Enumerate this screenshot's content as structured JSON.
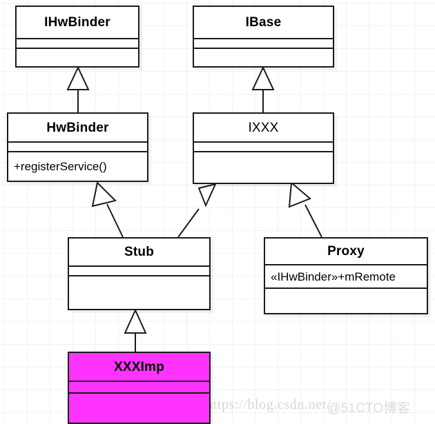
{
  "diagram": {
    "type": "uml-class-diagram",
    "background": "#ffffff",
    "grid_color": "#f2f2f2",
    "line_color": "#1a1a1a",
    "highlight_color": "#ff33ff",
    "classes": [
      {
        "id": "ihwbinder",
        "name": "IHwBinder",
        "title_bold": true,
        "attributes": "",
        "operations": "",
        "highlighted": false
      },
      {
        "id": "ibase",
        "name": "IBase",
        "title_bold": true,
        "attributes": "",
        "operations": "",
        "highlighted": false
      },
      {
        "id": "hwbinder",
        "name": "HwBinder",
        "title_bold": true,
        "attributes": "",
        "operations": "+registerService()",
        "highlighted": false
      },
      {
        "id": "ixxx",
        "name": "IXXX",
        "title_bold": false,
        "attributes": "",
        "operations": "",
        "highlighted": false
      },
      {
        "id": "stub",
        "name": "Stub",
        "title_bold": true,
        "attributes": "",
        "operations": "",
        "highlighted": false
      },
      {
        "id": "proxy",
        "name": "Proxy",
        "title_bold": true,
        "attributes": "«IHwBinder»+mRemote",
        "operations": "",
        "highlighted": false
      },
      {
        "id": "xxximp",
        "name": "XXXImp",
        "title_bold": true,
        "attributes": "",
        "operations": "",
        "highlighted": true
      }
    ],
    "relationships": [
      {
        "id": "hwbinder-ihwbinder",
        "type": "generalization",
        "from": "HwBinder",
        "to": "IHwBinder"
      },
      {
        "id": "ixxx-ibase",
        "type": "generalization",
        "from": "IXXX",
        "to": "IBase"
      },
      {
        "id": "stub-hwbinder",
        "type": "generalization",
        "from": "Stub",
        "to": "HwBinder"
      },
      {
        "id": "stub-ixxx",
        "type": "generalization",
        "from": "Stub",
        "to": "IXXX"
      },
      {
        "id": "proxy-ixxx",
        "type": "generalization",
        "from": "Proxy",
        "to": "IXXX"
      },
      {
        "id": "xxximp-stub",
        "type": "generalization",
        "from": "XXXImp",
        "to": "Stub"
      }
    ]
  },
  "watermarks": {
    "url": "https://blog.csdn.net/",
    "brand": "@51CTO博客"
  }
}
